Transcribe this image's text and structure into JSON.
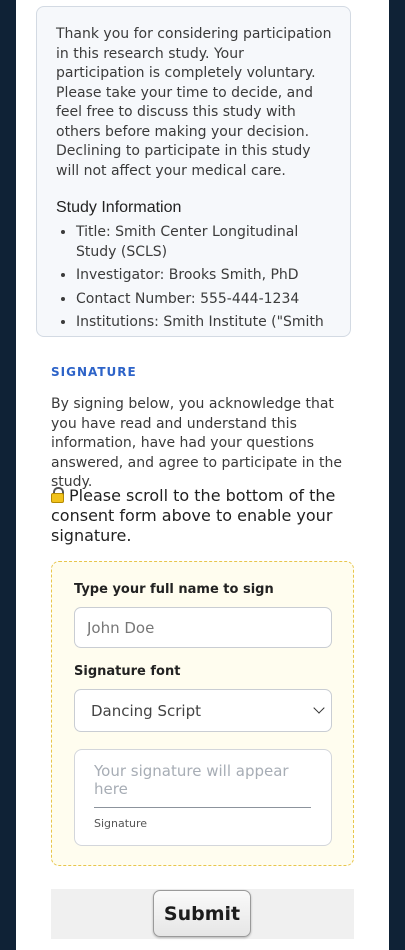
{
  "consent": {
    "intro": "Thank you for considering participation in this research study. Your participation is completely voluntary. Please take your time to decide, and feel free to discuss this study with others before making your decision. Declining to participate in this study will not affect your medical care.",
    "study_heading": "Study Information",
    "study_items": [
      "Title: Smith Center Longitudinal Study (SCLS)",
      "Investigator: Brooks Smith, PhD",
      "Contact Number: 555-444-1234",
      "Institutions: Smith Institute (\"Smith"
    ]
  },
  "signature": {
    "section_label": "SIGNATURE",
    "acknowledgement": "By signing below, you acknowledge that you have read and understand this information, have had your questions answered, and agree to participate in the study.",
    "lock_icon": "lock-icon",
    "lock_message": "Please scroll to the bottom of the consent form above to enable your signature.",
    "name_label": "Type your full name to sign",
    "name_placeholder": "John Doe",
    "name_value": "",
    "font_label": "Signature font",
    "font_selected": "Dancing Script",
    "preview_placeholder": "Your signature will appear here",
    "preview_caption": "Signature"
  },
  "submit": {
    "label": "Submit"
  },
  "colors": {
    "page_bg": "#0f2236",
    "accent": "#2d63c8",
    "card_border": "#e8c64c",
    "card_bg": "#fffdef"
  }
}
